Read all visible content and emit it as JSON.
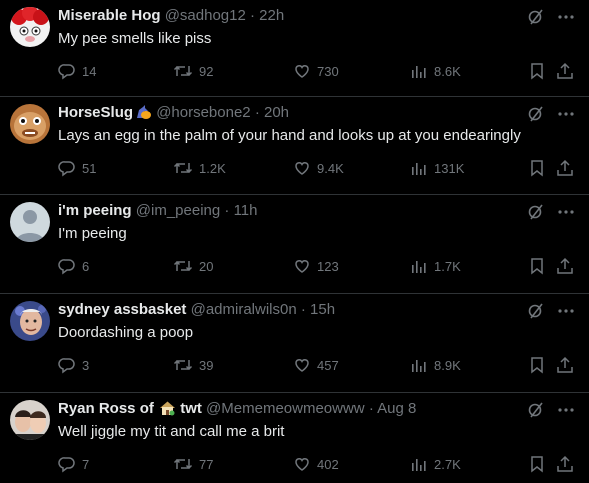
{
  "colors": {
    "background": "#000000",
    "text": "#e7e9ea",
    "muted": "#71767b",
    "divider": "#2f3336"
  },
  "tweets": [
    {
      "name": "Miserable Hog",
      "handle": "@sadhog12",
      "sep": "·",
      "time": "22h",
      "text": "My pee smells like piss",
      "replies": "14",
      "retweets": "92",
      "likes": "730",
      "views": "8.6K"
    },
    {
      "name": "HorseSlug",
      "handle": "@horsebone2",
      "sep": "·",
      "time": "20h",
      "text": "Lays an egg in the palm of your hand and looks up at you endearingly",
      "replies": "51",
      "retweets": "1.2K",
      "likes": "9.4K",
      "views": "131K"
    },
    {
      "name": "i'm peeing",
      "handle": "@im_peeing",
      "sep": "·",
      "time": "11h",
      "text": "I'm peeing",
      "replies": "6",
      "retweets": "20",
      "likes": "123",
      "views": "1.7K"
    },
    {
      "name": "sydney assbasket",
      "handle": "@admiralwils0n",
      "sep": "·",
      "time": "15h",
      "text": "Doordashing a poop",
      "replies": "3",
      "retweets": "39",
      "likes": "457",
      "views": "8.9K"
    },
    {
      "name_pre": "Ryan Ross of",
      "name_post": "twt",
      "handle": "@Mememeowmeowww",
      "sep": "·",
      "time": "Aug 8",
      "text": "Well jiggle my tit and call me a brit",
      "replies": "7",
      "retweets": "77",
      "likes": "402",
      "views": "2.7K"
    }
  ]
}
